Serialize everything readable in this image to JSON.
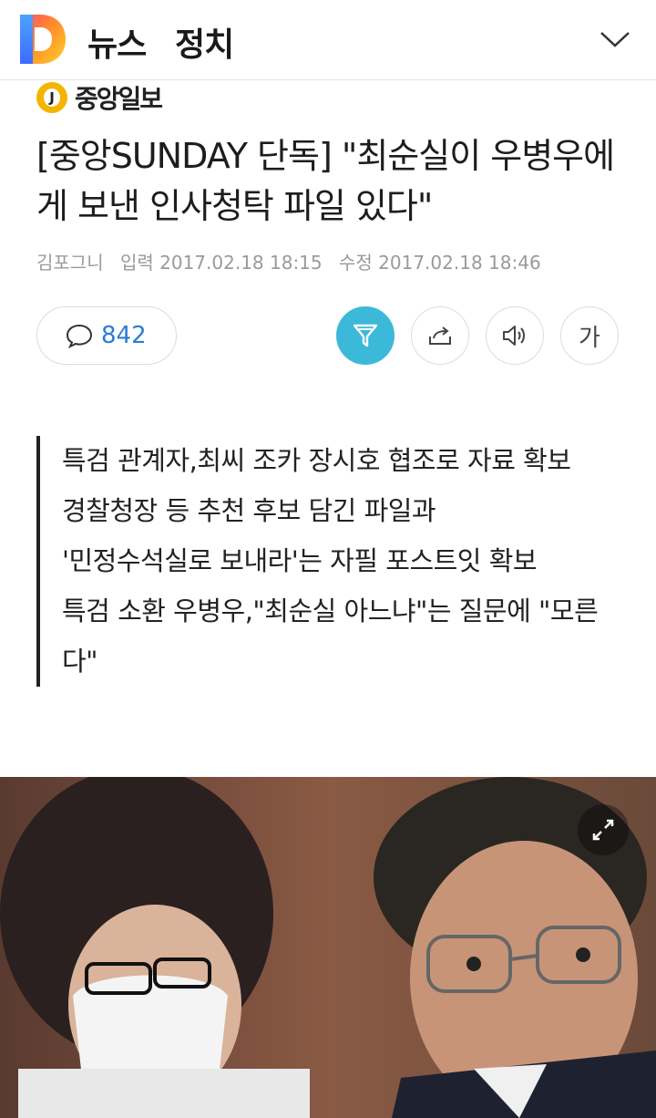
{
  "header": {
    "logo_letter": "D",
    "section": "뉴스",
    "category": "정치",
    "chevron": "chevron-down-icon"
  },
  "press": {
    "badge_letter": "J",
    "name": "중앙일보"
  },
  "article": {
    "headline": "[중앙SUNDAY 단독] \"최순실이 우병우에게 보낸 인사청탁 파일 있다\"",
    "author": "김포그니",
    "input_label": "입력 2017.02.18 18:15",
    "modified_label": "수정 2017.02.18 18:46"
  },
  "toolbar": {
    "comment_count": "842",
    "font_label": "가"
  },
  "summary": [
    "특검 관계자,최씨 조카 장시호 협조로 자료 확보",
    "경찰청장 등 추천 후보 담긴 파일과",
    "'민정수석실로 보내라'는 자필 포스트잇 확보",
    "특검 소환 우병우,\"최순실 아느냐\"는 질문에 \"모른다\""
  ],
  "colors": {
    "accent": "#3cb9d8",
    "comment_count": "#2b7dd1",
    "press_badge": "#f4b400"
  }
}
